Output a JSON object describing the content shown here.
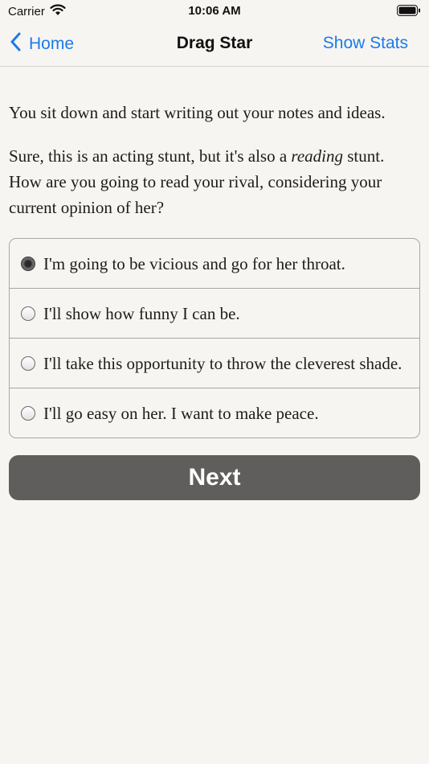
{
  "status_bar": {
    "carrier": "Carrier",
    "time": "10:06 AM",
    "icons": [
      "wifi-icon",
      "battery-icon"
    ]
  },
  "nav": {
    "back_label": "Home",
    "title": "Drag Star",
    "stats_label": "Show Stats",
    "accent_color": "#1a7bea"
  },
  "story": {
    "para1": "You sit down and start writing out your notes and ideas.",
    "para2_before": "Sure, this is an acting stunt, but it's also a ",
    "para2_emph": "reading",
    "para2_after": " stunt. How are you going to read your rival, considering your current opinion of her?"
  },
  "choices": [
    {
      "label": "I'm going to be vicious and go for her throat.",
      "selected": true
    },
    {
      "label": "I'll show how funny I can be.",
      "selected": false
    },
    {
      "label": "I'll take this opportunity to throw the cleverest shade.",
      "selected": false
    },
    {
      "label": "I'll go easy on her. I want to make peace.",
      "selected": false
    }
  ],
  "next_label": "Next"
}
